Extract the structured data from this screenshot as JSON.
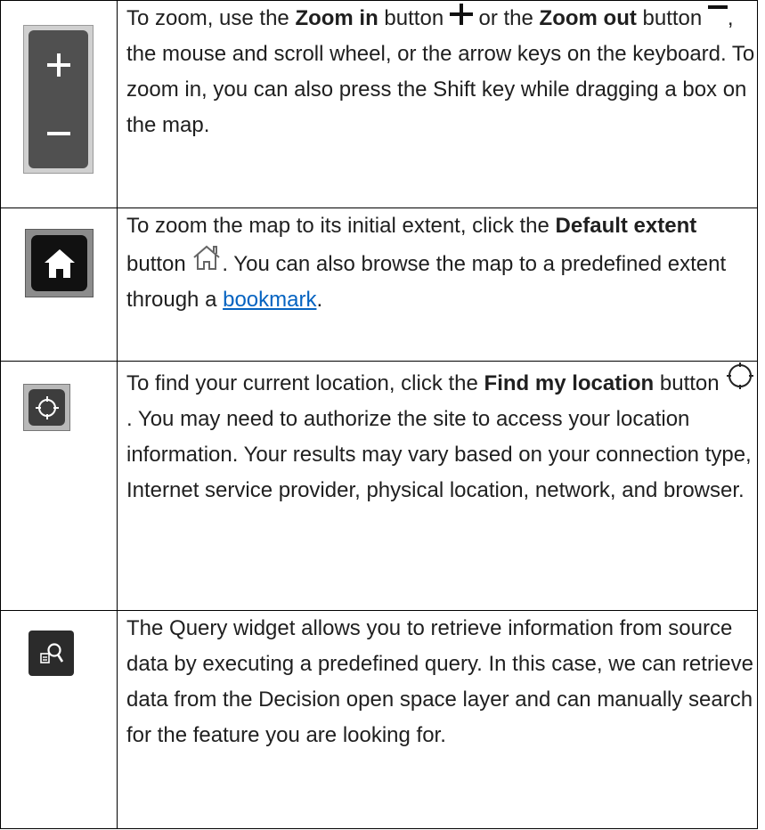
{
  "rows": [
    {
      "icon": "zoom-in-out-widget",
      "parts": {
        "t1": "To zoom, use the ",
        "b1": "Zoom in",
        "t2": " button ",
        "t3": " or the ",
        "b2": "Zoom out",
        "t4": " button ",
        "t5": ", the mouse and scroll wheel, or the arrow keys on the keyboard. To zoom in, you can also press the Shift key while dragging a box on the map."
      }
    },
    {
      "icon": "home-widget",
      "parts": {
        "t1": "To zoom the map to its initial extent, click the ",
        "b1": "Default extent",
        "t2": " button ",
        "t3": ". You can also browse the map to a predefined extent through a ",
        "link": "bookmark",
        "t4": "."
      }
    },
    {
      "icon": "locate-widget",
      "parts": {
        "t1": "To find your current location, click the ",
        "b1": "Find my location",
        "t2": " button ",
        "t3": ". You may need to authorize the site to access your location information. Your results may vary based on your connection type, Internet service provider, physical location, network, and browser."
      }
    },
    {
      "icon": "query-widget",
      "parts": {
        "t1": "The Query widget allows you to retrieve information from source data by executing a predefined query. In this case, we can retrieve data from the Decision open space layer and can manually search for the feature you are looking for."
      }
    }
  ],
  "colors": {
    "link": "#0563c1",
    "widget_dark": "#505050",
    "border": "#000000"
  }
}
